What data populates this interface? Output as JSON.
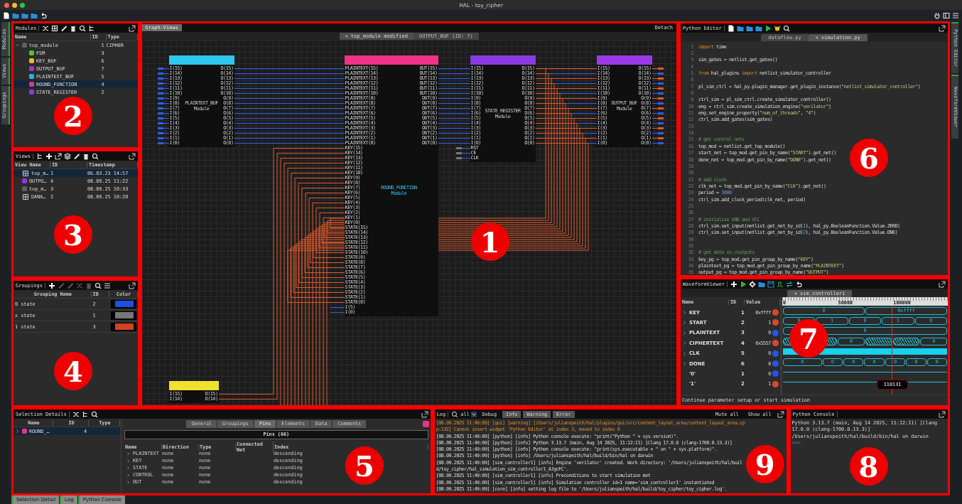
{
  "window": {
    "title": "HAL - toy_cipher"
  },
  "left_dock_tabs": [
    {
      "label": "Modules"
    },
    {
      "label": "Views"
    },
    {
      "label": "Groupings"
    }
  ],
  "modules_panel": {
    "title": "Modules",
    "callout": "2",
    "columns": [
      "Name",
      "ID",
      "Type"
    ],
    "tree": [
      {
        "name": "top_module",
        "id": "1",
        "type": "CIPHER",
        "color": "#5a6266",
        "expanded": true,
        "selected": false,
        "children": [
          {
            "name": "FSM",
            "id": "3",
            "color": "#44cc22",
            "selected": false
          },
          {
            "name": "KEY_BUF",
            "id": "6",
            "color": "#e0c020",
            "selected": false
          },
          {
            "name": "OUTPUT_BUF",
            "id": "7",
            "color": "#9933dd",
            "selected": false
          },
          {
            "name": "PLAINTEXT_BUF",
            "id": "5",
            "color": "#22b8e0",
            "selected": false
          },
          {
            "name": "ROUND_FUNCTION",
            "id": "4",
            "color": "#e8338a",
            "selected": true
          },
          {
            "name": "STATE_REGISTER",
            "id": "2",
            "color": "#8a3be0",
            "selected": false
          }
        ]
      }
    ]
  },
  "views_panel": {
    "title": "Views",
    "callout": "3",
    "columns": [
      "View Name",
      "ID",
      "Timestamp"
    ],
    "rows": [
      {
        "kind": "view",
        "name": "top_m…",
        "id": "1",
        "timestamp": "06.03.23 14:57",
        "selected": true
      },
      {
        "kind": "module",
        "color": "#9933dd",
        "name": "OUTPU…",
        "id": "4",
        "timestamp": "08.09.25 11:22",
        "selected": false
      },
      {
        "kind": "module",
        "color": "#5a6266",
        "name": "top_m…",
        "id": "3",
        "timestamp": "08.09.25 10:33",
        "selected": false
      },
      {
        "kind": "view",
        "name": "DANA…",
        "id": "2",
        "timestamp": "08.09.25 10:20",
        "selected": false
      }
    ]
  },
  "groupings_panel": {
    "title": "Groupings",
    "callout": "4",
    "columns": [
      "Grouping Name",
      "ID",
      "Color"
    ],
    "rows": [
      {
        "name": "0 state",
        "id": "2",
        "color": "#1f4fe0"
      },
      {
        "name": "x state",
        "id": "1",
        "color": "#777777"
      },
      {
        "name": "1 state",
        "id": "3",
        "color": "#cc4422"
      }
    ]
  },
  "graph_view": {
    "tab": "Graph-Views",
    "detach": "Detach",
    "callout": "1",
    "view_tabs": [
      {
        "close": "×",
        "label": "top_module modified",
        "selected": true
      },
      {
        "label": "OUTPUT_BUF (ID: 7)",
        "selected": false
      }
    ],
    "modules": [
      {
        "name": "PLAINTEXT_BUF",
        "type_label": "Module",
        "color": "#2ec8ee",
        "pins_left": [
          "I(15)",
          "I(14)",
          "I(13)",
          "I(12)",
          "I(11)",
          "I(10)",
          "I(9)",
          "I(8)",
          "I(7)",
          "I(6)",
          "I(5)",
          "I(4)",
          "I(3)",
          "I(2)",
          "I(1)",
          "I(0)"
        ],
        "pins_right": [
          "O(15)",
          "O(14)",
          "O(13)",
          "O(12)",
          "O(11)",
          "O(10)",
          "O(9)",
          "O(8)",
          "O(7)",
          "O(6)",
          "O(5)",
          "O(4)",
          "O(3)",
          "O(2)",
          "O(1)",
          "O(0)"
        ]
      },
      {
        "name": "ROUND_FUNCTION",
        "type_label": "Module",
        "color": "#ee3388",
        "pins_left": [
          "PLAINTEXT(15)",
          "PLAINTEXT(14)",
          "PLAINTEXT(13)",
          "PLAINTEXT(12)",
          "PLAINTEXT(11)",
          "PLAINTEXT(10)",
          "PLAINTEXT(9)",
          "PLAINTEXT(8)",
          "PLAINTEXT(7)",
          "PLAINTEXT(6)",
          "PLAINTEXT(5)",
          "PLAINTEXT(4)",
          "PLAINTEXT(3)",
          "PLAINTEXT(2)",
          "PLAINTEXT(1)",
          "PLAINTEXT(0)",
          "KEY(15)",
          "KEY(14)",
          "KEY(13)",
          "KEY(12)",
          "KEY(11)",
          "KEY(10)",
          "KEY(9)",
          "KEY(8)",
          "KEY(7)",
          "KEY(6)",
          "KEY(5)",
          "KEY(4)",
          "KEY(3)",
          "KEY(2)",
          "KEY(1)",
          "KEY(0)",
          "STATE(15)",
          "STATE(14)",
          "STATE(13)",
          "STATE(12)",
          "STATE(11)",
          "STATE(10)",
          "STATE(9)",
          "STATE(8)",
          "STATE(7)",
          "STATE(6)",
          "STATE(5)",
          "STATE(4)",
          "STATE(3)",
          "STATE(2)",
          "STATE(1)",
          "STATE(0)",
          "I(5)",
          "I(0)"
        ],
        "pins_right": [
          "OUT(15)",
          "OUT(14)",
          "OUT(13)",
          "OUT(12)",
          "OUT(11)",
          "OUT(10)",
          "OUT(9)",
          "OUT(8)",
          "OUT(7)",
          "OUT(6)",
          "OUT(5)",
          "OUT(4)",
          "OUT(3)",
          "OUT(2)",
          "OUT(1)",
          "OUT(0)"
        ]
      },
      {
        "name": "STATE_REGISTER",
        "type_label": "Module",
        "color": "#8a3be0",
        "pins_left": [
          "I(15)",
          "I(14)",
          "I(13)",
          "I(12)",
          "I(11)",
          "I(10)",
          "I(9)",
          "I(8)",
          "I(7)",
          "I(6)",
          "I(5)",
          "I(4)",
          "I(3)",
          "I(2)",
          "I(1)",
          "I(0)",
          "RST",
          "CE",
          "CLK"
        ],
        "pins_right": [
          "O(15)",
          "O(14)",
          "O(13)",
          "O(12)",
          "O(11)",
          "O(10)",
          "O(9)",
          "O(8)",
          "O(7)",
          "O(6)",
          "O(5)",
          "O(4)",
          "O(3)",
          "O(2)",
          "O(1)",
          "O(0)"
        ]
      },
      {
        "name": "OUTPUT_BUF",
        "type_label": "Module",
        "color": "#9b3be8",
        "pins_left": [
          "I(15)",
          "I(14)",
          "I(13)",
          "I(12)",
          "I(11)",
          "I(10)",
          "I(9)",
          "I(8)",
          "I(7)",
          "I(6)",
          "I(5)",
          "I(4)",
          "I(3)",
          "I(2)",
          "I(1)",
          "I(0)"
        ],
        "pins_right": [
          "O(15)",
          "O(14)",
          "O(13)",
          "O(12)",
          "O(11)",
          "O(10)",
          "O(9)",
          "O(8)",
          "O(7)",
          "O(6)",
          "O(5)",
          "O(4)",
          "O(3)",
          "O(2)",
          "O(1)",
          "O(0)"
        ]
      },
      {
        "color": "#f0e030",
        "pins_left": [
          "I(15)",
          "I(14)"
        ],
        "pins_right": [
          "O(15)",
          "O(14)"
        ]
      }
    ]
  },
  "python_editor": {
    "title": "Python Editor",
    "callout": "6",
    "tabs": [
      {
        "label": "dataflow.py",
        "selected": false
      },
      {
        "close": "×",
        "label": "simulation.py",
        "selected": true
      }
    ],
    "lines": [
      {
        "number": "1",
        "segments": [
          {
            "kind": "keyword",
            "text": "import"
          },
          {
            "kind": "plain",
            "text": " time"
          }
        ]
      },
      {
        "number": "2"
      },
      {
        "number": "3",
        "segments": [
          {
            "kind": "plain",
            "text": "sim_gates = netlist.get_gates()"
          }
        ]
      },
      {
        "number": "4"
      },
      {
        "number": "5",
        "segments": [
          {
            "kind": "keyword",
            "text": "from"
          },
          {
            "kind": "plain",
            "text": " hal_plugins "
          },
          {
            "kind": "keyword",
            "text": "import"
          },
          {
            "kind": "plain",
            "text": " netlist_simulator_controller"
          }
        ]
      },
      {
        "number": "6"
      },
      {
        "number": "7",
        "segments": [
          {
            "kind": "plain",
            "text": "pl_sim_ctrl = hal_py.plugin_manager.get_plugin_instance("
          },
          {
            "kind": "string",
            "text": "\"netlist_simulator_controller\""
          },
          {
            "kind": "plain",
            "text": ")"
          }
        ]
      },
      {
        "number": "8"
      },
      {
        "number": "9",
        "segments": [
          {
            "kind": "plain",
            "text": "ctrl_sim = pl_sim_ctrl.create_simulator_controller()"
          }
        ]
      },
      {
        "number": "10",
        "segments": [
          {
            "kind": "plain",
            "text": "eng = ctrl_sim.create_simulation_engine("
          },
          {
            "kind": "string",
            "text": "\"verilator\""
          },
          {
            "kind": "plain",
            "text": ")"
          }
        ]
      },
      {
        "number": "11",
        "segments": [
          {
            "kind": "plain",
            "text": "eng.set_engine_property("
          },
          {
            "kind": "string",
            "text": "\"num_of_threads\""
          },
          {
            "kind": "plain",
            "text": ", "
          },
          {
            "kind": "string",
            "text": "\"4\""
          },
          {
            "kind": "plain",
            "text": ")"
          }
        ]
      },
      {
        "number": "12",
        "segments": [
          {
            "kind": "plain",
            "text": "ctrl_sim.add_gates(sim_gates)"
          }
        ]
      },
      {
        "number": "13"
      },
      {
        "number": "14"
      },
      {
        "number": "15",
        "segments": [
          {
            "kind": "comment",
            "text": "# get control nets"
          }
        ]
      },
      {
        "number": "16",
        "segments": [
          {
            "kind": "plain",
            "text": "top_mod = netlist.get_top_module()"
          }
        ]
      },
      {
        "number": "17",
        "segments": [
          {
            "kind": "plain",
            "text": "start_net = top_mod.get_pin_by_name("
          },
          {
            "kind": "string",
            "text": "\"START\""
          },
          {
            "kind": "plain",
            "text": ").get_net()"
          }
        ]
      },
      {
        "number": "18",
        "segments": [
          {
            "kind": "plain",
            "text": "done_net = top_mod.get_pin_by_name("
          },
          {
            "kind": "string",
            "text": "\"DONE\""
          },
          {
            "kind": "plain",
            "text": ").get_net()"
          }
        ]
      },
      {
        "number": "19"
      },
      {
        "number": "20"
      },
      {
        "number": "21",
        "segments": [
          {
            "kind": "comment",
            "text": "# add clock"
          }
        ]
      },
      {
        "number": "22",
        "segments": [
          {
            "kind": "plain",
            "text": "clk_net = top_mod.get_pin_by_name("
          },
          {
            "kind": "string",
            "text": "\"CLK\""
          },
          {
            "kind": "plain",
            "text": ").get_net()"
          }
        ]
      },
      {
        "number": "23",
        "segments": [
          {
            "kind": "plain",
            "text": "period = "
          },
          {
            "kind": "number",
            "text": "1000"
          }
        ]
      },
      {
        "number": "24",
        "segments": [
          {
            "kind": "plain",
            "text": "ctrl_sim.add_clock_period(clk_net, period)"
          }
        ]
      },
      {
        "number": "25"
      },
      {
        "number": "26"
      },
      {
        "number": "27",
        "segments": [
          {
            "kind": "comment",
            "text": "# initialize GND and VCC"
          }
        ]
      },
      {
        "number": "28",
        "segments": [
          {
            "kind": "plain",
            "text": "ctrl_sim.set_input(netlist.get_net_by_id("
          },
          {
            "kind": "number",
            "text": "1"
          },
          {
            "kind": "plain",
            "text": "), hal_py.BooleanFunction.Value.ZERO)"
          }
        ]
      },
      {
        "number": "29",
        "segments": [
          {
            "kind": "plain",
            "text": "ctrl_sim.set_input(netlist.get_net_by_id("
          },
          {
            "kind": "number",
            "text": "2"
          },
          {
            "kind": "plain",
            "text": "), hal_py.BooleanFunction.Value.ONE)"
          }
        ]
      },
      {
        "number": "30"
      },
      {
        "number": "31"
      },
      {
        "number": "32",
        "segments": [
          {
            "kind": "comment",
            "text": "# get data in-/outputs"
          }
        ]
      },
      {
        "number": "33",
        "segments": [
          {
            "kind": "plain",
            "text": "key_pg = top_mod.get_pin_group_by_name("
          },
          {
            "kind": "string",
            "text": "\"KEY\""
          },
          {
            "kind": "plain",
            "text": ")"
          }
        ]
      },
      {
        "number": "34",
        "segments": [
          {
            "kind": "plain",
            "text": "plaintext_pg = top_mod.get_pin_group_by_name("
          },
          {
            "kind": "string",
            "text": "\"PLAINTEXT\""
          },
          {
            "kind": "plain",
            "text": ")"
          }
        ]
      },
      {
        "number": "35",
        "segments": [
          {
            "kind": "plain",
            "text": "output_pg = top_mod.get_pin_group_by_name("
          },
          {
            "kind": "string",
            "text": "\"OUTPUT\""
          },
          {
            "kind": "plain",
            "text": ")"
          }
        ]
      }
    ]
  },
  "waveform_viewer": {
    "title": "WaveformViewer",
    "callout": "7",
    "tabs": [
      {
        "close": "×",
        "label": "sim_controller1",
        "selected": true
      }
    ],
    "columns": [
      "Name",
      "ID",
      "Value"
    ],
    "axis_labels": [
      "0",
      "50000",
      "100000"
    ],
    "cursor_label": "110131",
    "status": "Continue parameter setup or start simulation",
    "rows": [
      {
        "name": "KEY",
        "id": "1",
        "value": "0xffff",
        "color": "#d9482b",
        "expanded": false,
        "kind": "bus",
        "segments": [
          {
            "kind": "value",
            "label": "0"
          },
          {
            "kind": "value",
            "label": "0xffff"
          }
        ]
      },
      {
        "name": "START",
        "id": "2",
        "value": "1",
        "color": "#d9482b",
        "expanded": false,
        "kind": "bus",
        "segments": [
          {
            "kind": "value",
            "label": "0"
          },
          {
            "kind": "value",
            "label": "1"
          },
          {
            "kind": "value",
            "label": "0"
          },
          {
            "kind": "value",
            "label": "1"
          },
          {
            "kind": "value",
            "label": "0"
          }
        ]
      },
      {
        "name": "PLAINTEXT",
        "id": "3",
        "value": "0",
        "color": "#2255ee",
        "expanded": false,
        "kind": "bus",
        "segments": [
          {
            "kind": "value",
            "label": "0"
          }
        ]
      },
      {
        "name": "CIPHERTEXT",
        "id": "4",
        "value": "0x5557",
        "color": "#d9482b",
        "expanded": false,
        "kind": "bus",
        "segments": [
          {
            "kind": "busy"
          },
          {
            "kind": "busy"
          },
          {
            "kind": "value",
            "label": "0"
          },
          {
            "kind": "busy"
          },
          {
            "kind": "busy"
          },
          {
            "kind": "value",
            "label": "0"
          }
        ]
      },
      {
        "name": "CLK",
        "id": "5",
        "value": "0",
        "color": "#2255ee",
        "expanded": false,
        "kind": "clock"
      },
      {
        "name": "DONE",
        "id": "6",
        "value": "0",
        "color": "#2255ee",
        "expanded": false,
        "kind": "bus",
        "segments": [
          {
            "kind": "value",
            "label": "0"
          },
          {
            "kind": "value",
            "label": "0"
          },
          {
            "kind": "value",
            "label": "0"
          },
          {
            "kind": "value",
            "label": "0"
          },
          {
            "kind": "value",
            "label": "0"
          },
          {
            "kind": "value",
            "label": "0"
          },
          {
            "kind": "value",
            "label": "0"
          }
        ]
      },
      {
        "name": "'0'",
        "id": "1",
        "value": "0",
        "color": "#2255ee",
        "kind": "low"
      },
      {
        "name": "'1'",
        "id": "2",
        "value": "1",
        "color": "#d9482b",
        "kind": "high"
      }
    ]
  },
  "right_dock_tabs": [
    {
      "label": "Python Editor"
    },
    {
      "label": "WaveformViewer"
    }
  ],
  "selection_details": {
    "title": "Selection Details",
    "callout": "5",
    "columns": [
      "Name",
      "ID",
      "Type"
    ],
    "items": [
      {
        "name": "ROUND_…",
        "id": "4",
        "color": "#e8338a",
        "expanded": false
      }
    ],
    "tabs": [
      {
        "label": "General",
        "selected": false
      },
      {
        "label": "Groupings",
        "selected": false
      },
      {
        "label": "Pins",
        "selected": true
      },
      {
        "label": "Elements",
        "selected": false
      },
      {
        "label": "Data",
        "selected": false
      },
      {
        "label": "Comments",
        "selected": false
      }
    ],
    "pins_title": "Pins (66)",
    "pin_columns": [
      "Name",
      "Direction",
      "Type",
      "Connected Net",
      "Index"
    ],
    "pins": [
      {
        "name": "PLAINTEXT",
        "direction": "none",
        "type": "none",
        "index": "descending",
        "expanded": false
      },
      {
        "name": "KEY",
        "direction": "none",
        "type": "none",
        "index": "descending",
        "expanded": false
      },
      {
        "name": "STATE",
        "direction": "none",
        "type": "none",
        "index": "descending",
        "expanded": false
      },
      {
        "name": "CONTROL",
        "direction": "none",
        "type": "none",
        "index": "descending",
        "expanded": false
      },
      {
        "name": "OUT",
        "direction": "none",
        "type": "none",
        "index": "descending",
        "expanded": false
      }
    ]
  },
  "log": {
    "title": "Log",
    "filter": "all",
    "callout": "9",
    "tabs": [
      {
        "label": "Debug",
        "selected": true
      },
      {
        "label": "Info",
        "selected": false
      },
      {
        "label": "Warning",
        "selected": false
      },
      {
        "label": "Error",
        "selected": false
      }
    ],
    "buttons": [
      "Mute all",
      "Show all"
    ],
    "lines": [
      {
        "kind": "warning",
        "text": "[08.09.2025 11:49:09] [gui] [warning] [/Users/julianspeith/hal/plugins/gui/src/content_layout_area/content_layout_area.cpp:132] Cannot insert widget 'Python Editor' at index 3, moved to index 0"
      },
      {
        "kind": "info",
        "text": "[08.09.2025 11:49:09] [python] [info] Python console execute: \"print(\"Python \" + sys.version)\"."
      },
      {
        "kind": "info",
        "text": "[08.09.2025 11:49:09] [python] [info] Python 3.13.7 (main, Aug 14 2025, 11:12:11) [Clang 17.0.0 (clang-1700.0.13.3)]"
      },
      {
        "kind": "info",
        "text": "[08.09.2025 11:49:09] [python] [info] Python console execute: \"print(sys.executable + \" on \" + sys.platform)\"."
      },
      {
        "kind": "info",
        "text": "[08.09.2025 11:49:09] [python] [info] /Users/julianspeith/hal/build/bin/hal on darwin"
      },
      {
        "kind": "info",
        "text": "[08.09.2025 11:49:09] [sim_controller1] [info] Engine 'verilator' created. Work directory: '/Users/julianspeith/hal/build/toy_cipher/hal_simulation_sim_controller1_AJgcFC'."
      },
      {
        "kind": "info",
        "text": "[08.09.2025 11:49:09] [sim_controller1] [info] Preconditions to start simulation met"
      },
      {
        "kind": "info",
        "text": "[08.09.2025 11:49:09] [sim_controller1] [info] Simulation controller id=1 name='sim_controller1' instantiated"
      },
      {
        "kind": "info",
        "text": "[08.09.2025 11:49:09] [core] [info] setting log file to '/Users/julianspeith/hal/build/toy_cipher/toy_cipher.log'."
      }
    ]
  },
  "python_console": {
    "title": "Python Console",
    "callout": "8",
    "lines": [
      {
        "kind": "output",
        "text": "Python 3.13.7 (main, Aug 14 2025, 11:12:11) [Clang 17.0.0 (clang-1700.0.13.3)]"
      },
      {
        "kind": "output",
        "text": "/Users/julianspeith/hal/build/bin/hal on darwin"
      },
      {
        "kind": "prompt",
        "text": ">>>"
      }
    ]
  },
  "bottom_dock_tabs": [
    {
      "label": "Selection Detail"
    },
    {
      "label": "Log"
    },
    {
      "label": "Python Console"
    }
  ]
}
